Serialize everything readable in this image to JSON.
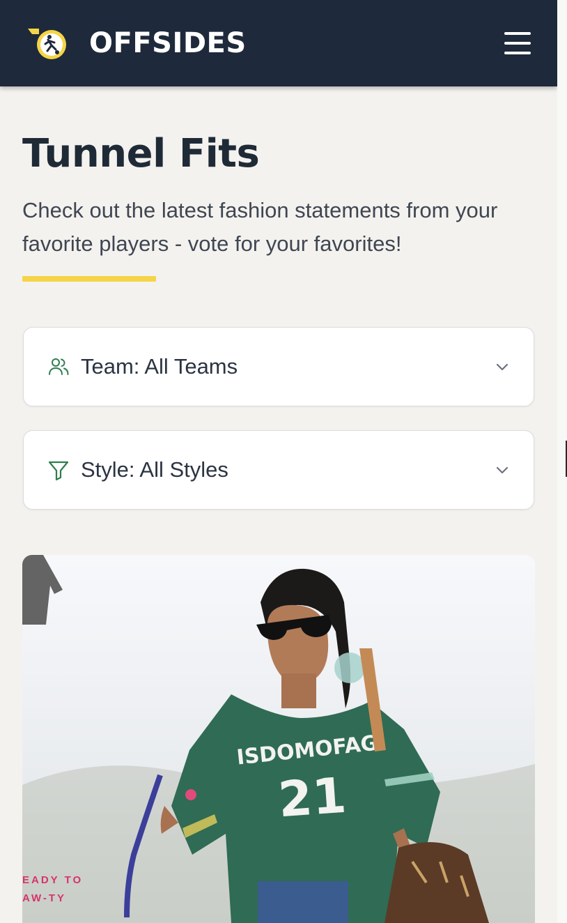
{
  "header": {
    "brand": "OFFSIDES",
    "logo_icon": "soccer-player-ball-icon",
    "menu_icon": "hamburger-menu-icon",
    "colors": {
      "background": "#1e2a3b",
      "logo_accent": "#f5d547"
    }
  },
  "page": {
    "title": "Tunnel Fits",
    "subtitle": "Check out the latest fashion statements from your favorite players - vote for your favorites!",
    "accent_color": "#f5d547"
  },
  "filters": {
    "team": {
      "label": "Team: All Teams",
      "icon": "users-icon",
      "chevron": "chevron-down-icon"
    },
    "style": {
      "label": "Style: All Styles",
      "icon": "filter-funnel-icon",
      "chevron": "chevron-down-icon"
    },
    "icon_color": "#2f7d4f"
  },
  "photo": {
    "caption_lines": [
      "EADY TO",
      "AW-TY"
    ],
    "jersey_text": "ISDOMOFAG",
    "jersey_number": "21",
    "colors": {
      "jersey": "#2f6b55",
      "caption": "#d6336c"
    }
  }
}
